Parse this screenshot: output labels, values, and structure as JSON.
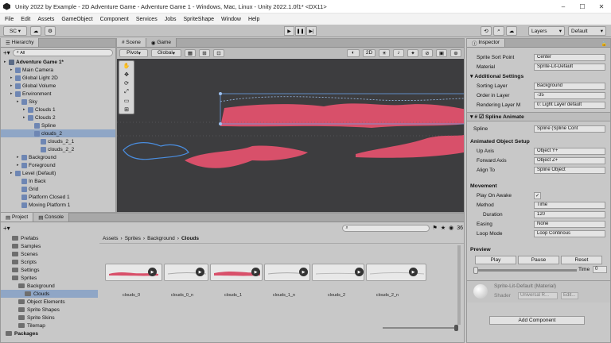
{
  "window": {
    "title": "Unity 2022 by Example - 2D Adventure Game - Adventure Game 1 - Windows, Mac, Linux - Unity 2022.1.0f1* <DX11>",
    "controls": [
      "–",
      "☐",
      "✕"
    ]
  },
  "menu": [
    "File",
    "Edit",
    "Assets",
    "GameObject",
    "Component",
    "Services",
    "Jobs",
    "SpriteShape",
    "Window",
    "Help"
  ],
  "toolbar": {
    "account": "SC",
    "layers": "Layers",
    "layout": "Default"
  },
  "hierarchy": {
    "tab": "Hierarchy",
    "search": "All",
    "items": [
      {
        "label": "Adventure Game 1*",
        "depth": 0,
        "bold": true
      },
      {
        "label": "Main Camera",
        "depth": 1
      },
      {
        "label": "Global Light 2D",
        "depth": 1
      },
      {
        "label": "Global Volume",
        "depth": 1
      },
      {
        "label": "Environment",
        "depth": 1
      },
      {
        "label": "Sky",
        "depth": 2
      },
      {
        "label": "Clouds 1",
        "depth": 3
      },
      {
        "label": "Clouds 2",
        "depth": 3
      },
      {
        "label": "Spline",
        "depth": 4
      },
      {
        "label": "clouds_2",
        "depth": 4,
        "selected": true
      },
      {
        "label": "clouds_2_1",
        "depth": 5
      },
      {
        "label": "clouds_2_2",
        "depth": 5
      },
      {
        "label": "Background",
        "depth": 2
      },
      {
        "label": "Foreground",
        "depth": 2
      },
      {
        "label": "Level (Default)",
        "depth": 1
      },
      {
        "label": "In Back",
        "depth": 2
      },
      {
        "label": "Grid",
        "depth": 2
      },
      {
        "label": "Platform Closed 1",
        "depth": 2
      },
      {
        "label": "Moving Platform 1",
        "depth": 2
      }
    ]
  },
  "scene": {
    "tabs": [
      "Scene",
      "Game"
    ],
    "pivot": "Pivot",
    "global": "Global",
    "gizmo_value": "2D"
  },
  "project": {
    "tabs": [
      "Project",
      "Console"
    ],
    "breadcrumb": [
      "Assets",
      "Sprites",
      "Background",
      "Clouds"
    ],
    "count": "36",
    "folders": [
      {
        "label": "Prefabs",
        "depth": 1
      },
      {
        "label": "Samples",
        "depth": 1
      },
      {
        "label": "Scenes",
        "depth": 1
      },
      {
        "label": "Scripts",
        "depth": 1
      },
      {
        "label": "Settings",
        "depth": 1
      },
      {
        "label": "Sprites",
        "depth": 1
      },
      {
        "label": "Background",
        "depth": 2
      },
      {
        "label": "Clouds",
        "depth": 3,
        "selected": true
      },
      {
        "label": "Object Elements",
        "depth": 2
      },
      {
        "label": "Sprite Shapes",
        "depth": 2
      },
      {
        "label": "Sprite Skins",
        "depth": 2
      },
      {
        "label": "Tilemap",
        "depth": 2
      },
      {
        "label": "Packages",
        "depth": 0,
        "bold": true
      }
    ],
    "assets": [
      "clouds_0",
      "clouds_0_n",
      "clouds_1",
      "clouds_1_n",
      "clouds_2",
      "clouds_2_n"
    ]
  },
  "inspector": {
    "tab": "Inspector",
    "top_rows": [
      {
        "label": "Sprite Sort Point",
        "value": "Center"
      },
      {
        "label": "Material",
        "value": "Sprite-Lit-Default"
      }
    ],
    "additional_settings": "Additional Settings",
    "settings_rows": [
      {
        "label": "Sorting Layer",
        "value": "Background"
      },
      {
        "label": "Order in Layer",
        "value": "-35"
      },
      {
        "label": "Rendering Layer M",
        "value": "0: Light Layer default"
      }
    ],
    "component": "Spline Animate",
    "spline_row": {
      "label": "Spline",
      "value": "Spline (Spline Cont"
    },
    "setup_header": "Animated Object Setup",
    "setup_rows": [
      {
        "label": "Up Axis",
        "value": "Object Y+"
      },
      {
        "label": "Forward Axis",
        "value": "Object Z+"
      },
      {
        "label": "Align To",
        "value": "Spline Object"
      }
    ],
    "movement_header": "Movement",
    "movement_rows": [
      {
        "label": "Play On Awake",
        "value": "✓"
      },
      {
        "label": "Method",
        "value": "Time"
      },
      {
        "label": "Duration",
        "value": "120"
      },
      {
        "label": "Easing",
        "value": "None"
      },
      {
        "label": "Loop Mode",
        "value": "Loop Continous"
      }
    ],
    "preview_header": "Preview",
    "preview_buttons": [
      "Play",
      "Pause",
      "Reset"
    ],
    "time_label": "Time",
    "time_value": "0",
    "material_name": "Sprite-Lit-Default (Material)",
    "shader_label": "Shader",
    "shader_value": "Universal R...",
    "edit_label": "Edit...",
    "add_component": "Add Component"
  },
  "colors": {
    "cloud": "#d8506a",
    "scene_bg": "#3d3d3f",
    "selection": "#8fa6c6"
  }
}
